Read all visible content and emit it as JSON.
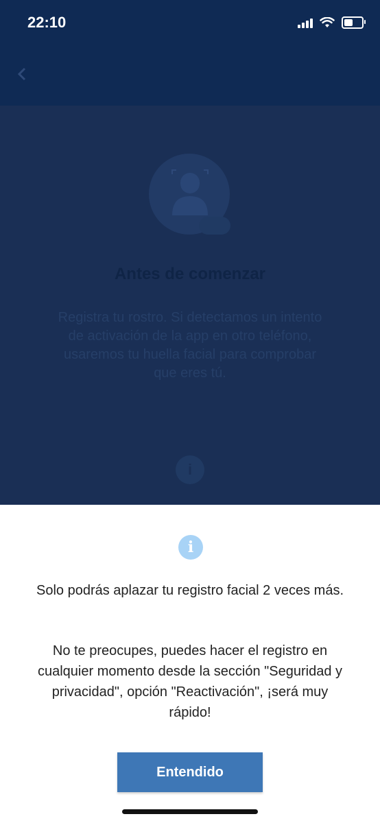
{
  "status_bar": {
    "time": "22:10",
    "battery_level": 0.5
  },
  "icons": {
    "back": "back-arrow-icon",
    "face": "face-scan-icon",
    "info": "info-icon",
    "wifi": "wifi-icon",
    "signal": "signal-icon",
    "battery": "battery-icon"
  },
  "background_screen": {
    "title": "Antes de comenzar",
    "body": "Registra tu rostro. Si detectamos un intento de activación de la app en otro teléfono, usaremos tu huella facial para comprobar que eres tú."
  },
  "sheet": {
    "info_glyph": "i",
    "message_1": "Solo podrás aplazar tu registro facial 2 veces más.",
    "message_2": "No te preocupes, puedes hacer el registro en cualquier momento desde la sección \"Seguridad y privacidad\", opción \"Reactivación\", ¡será muy rápido!",
    "button_label": "Entendido"
  },
  "colors": {
    "header": "#0f2a54",
    "overlay": "#1a2f55",
    "button": "#3e77b6",
    "info": "#a8d3f6"
  }
}
